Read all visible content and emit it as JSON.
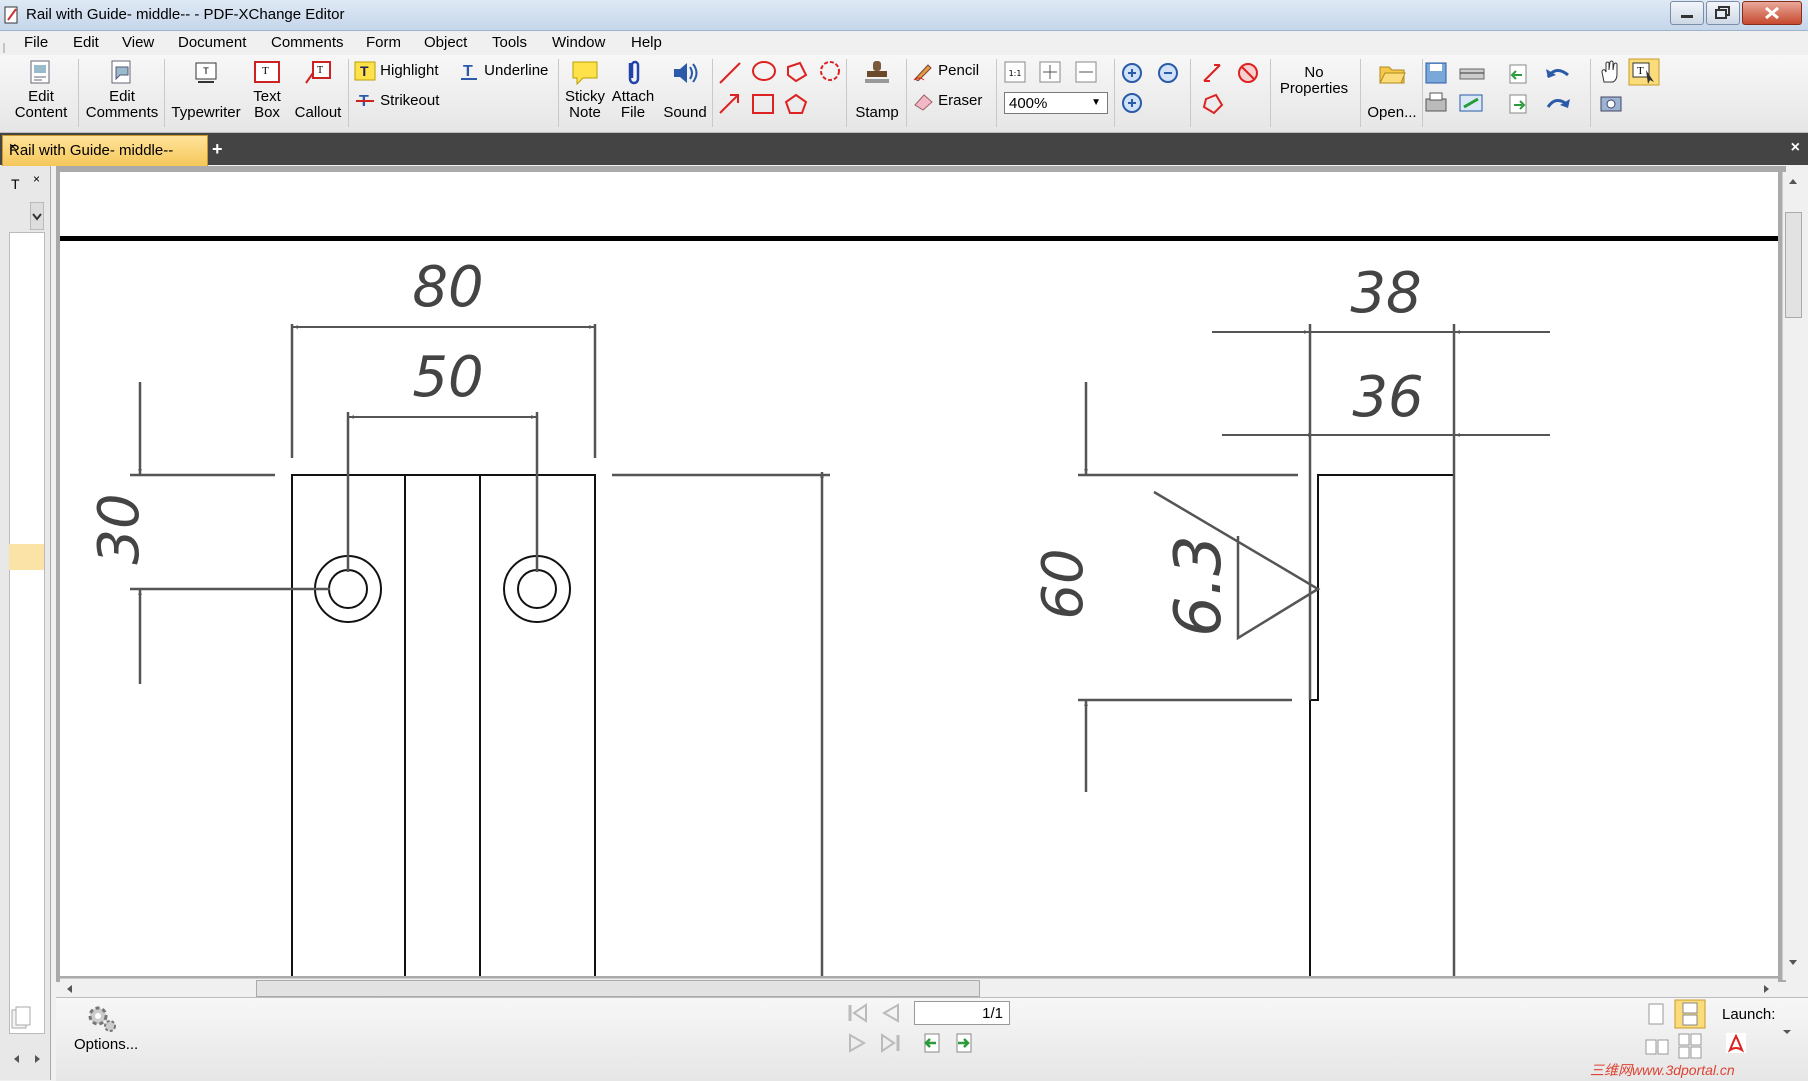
{
  "window": {
    "title": "Rail with Guide- middle-- - PDF-XChange Editor"
  },
  "menu": [
    "File",
    "Edit",
    "View",
    "Document",
    "Comments",
    "Form",
    "Object",
    "Tools",
    "Window",
    "Help"
  ],
  "toolbar": {
    "edit_content": [
      "Edit",
      "Content"
    ],
    "edit_comments": [
      "Edit",
      "Comments"
    ],
    "typewriter": "Typewriter",
    "text_box": [
      "Text",
      "Box"
    ],
    "callout": "Callout",
    "highlight": "Highlight",
    "underline": "Underline",
    "strikeout": "Strikeout",
    "sticky_note": [
      "Sticky",
      "Note"
    ],
    "attach_file": [
      "Attach",
      "File"
    ],
    "sound": "Sound",
    "stamp": "Stamp",
    "pencil": "Pencil",
    "eraser": "Eraser",
    "zoom_value": "400%",
    "actual_size": "1:1",
    "no_properties": [
      "No",
      "Properties"
    ],
    "open": "Open..."
  },
  "tabs": {
    "active": "Rail with Guide- middle--",
    "close_glyph": "×",
    "new_glyph": "+"
  },
  "left_panel": {
    "tab_label": "T"
  },
  "drawing": {
    "dim_80": "80",
    "dim_50": "50",
    "dim_30": "30",
    "dim_38": "38",
    "dim_36": "36",
    "dim_60": "60",
    "dim_6_3": "6.3"
  },
  "status": {
    "options": "Options...",
    "page_indicator": "1/1",
    "launch": "Launch:"
  },
  "watermark": "三维网www.3dportal.cn",
  "colors": {
    "tab_active": "#f5c75a",
    "tabbar": "#444444",
    "dimension": "#555555"
  }
}
